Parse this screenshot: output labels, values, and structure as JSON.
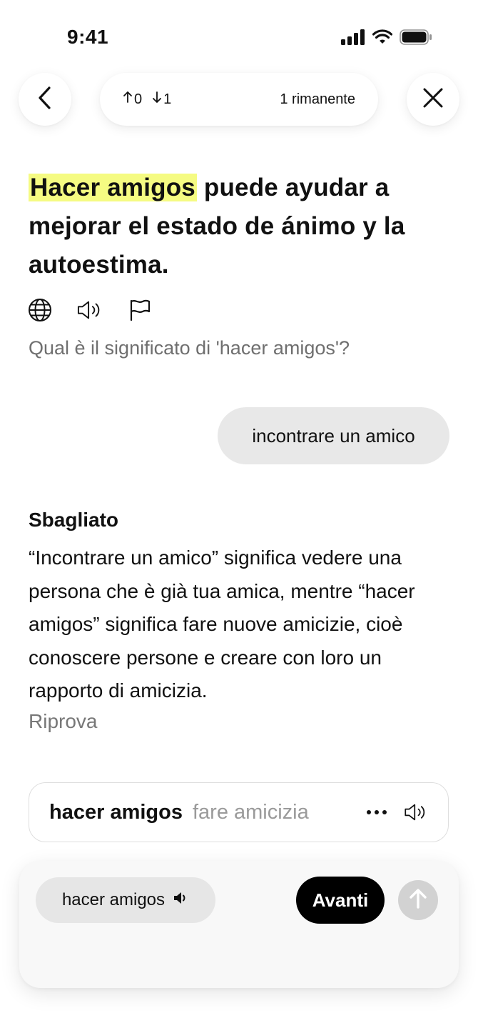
{
  "status_bar": {
    "time": "9:41",
    "icons": [
      "cellular-signal-icon",
      "wifi-icon",
      "battery-icon"
    ]
  },
  "top_bar": {
    "back_icon": "chevron-left-icon",
    "close_icon": "close-icon",
    "up_count": "0",
    "down_count": "1",
    "remaining": "1 rimanente"
  },
  "exercise": {
    "sentence_highlight": "Hacer amigos",
    "sentence_rest": " puede ayudar a mejorar el estado de ánimo y la autoestima.",
    "tools": [
      "globe-icon",
      "speaker-icon",
      "flag-icon"
    ],
    "question": "Qual è il significato di 'hacer amigos'?",
    "user_answer": "incontrare un amico"
  },
  "feedback": {
    "verdict": "Sbagliato",
    "explanation": "“Incontrare un amico” significa vedere una persona che è già tua amica, mentre “hacer amigos” significa fare nuove amicizie, cioè conoscere persone e creare con loro un rapporto di amicizia.",
    "retry": "Riprova"
  },
  "vocab_card": {
    "word": "hacer amigos",
    "translation": "fare amicizia"
  },
  "bottom_panel": {
    "chip_label": "hacer amigos",
    "next_label": "Avanti"
  },
  "colors": {
    "highlight": "#f5fb82",
    "next_button": "#000000",
    "send_button": "#d2d2d2",
    "bubble": "#e8e8e8"
  }
}
